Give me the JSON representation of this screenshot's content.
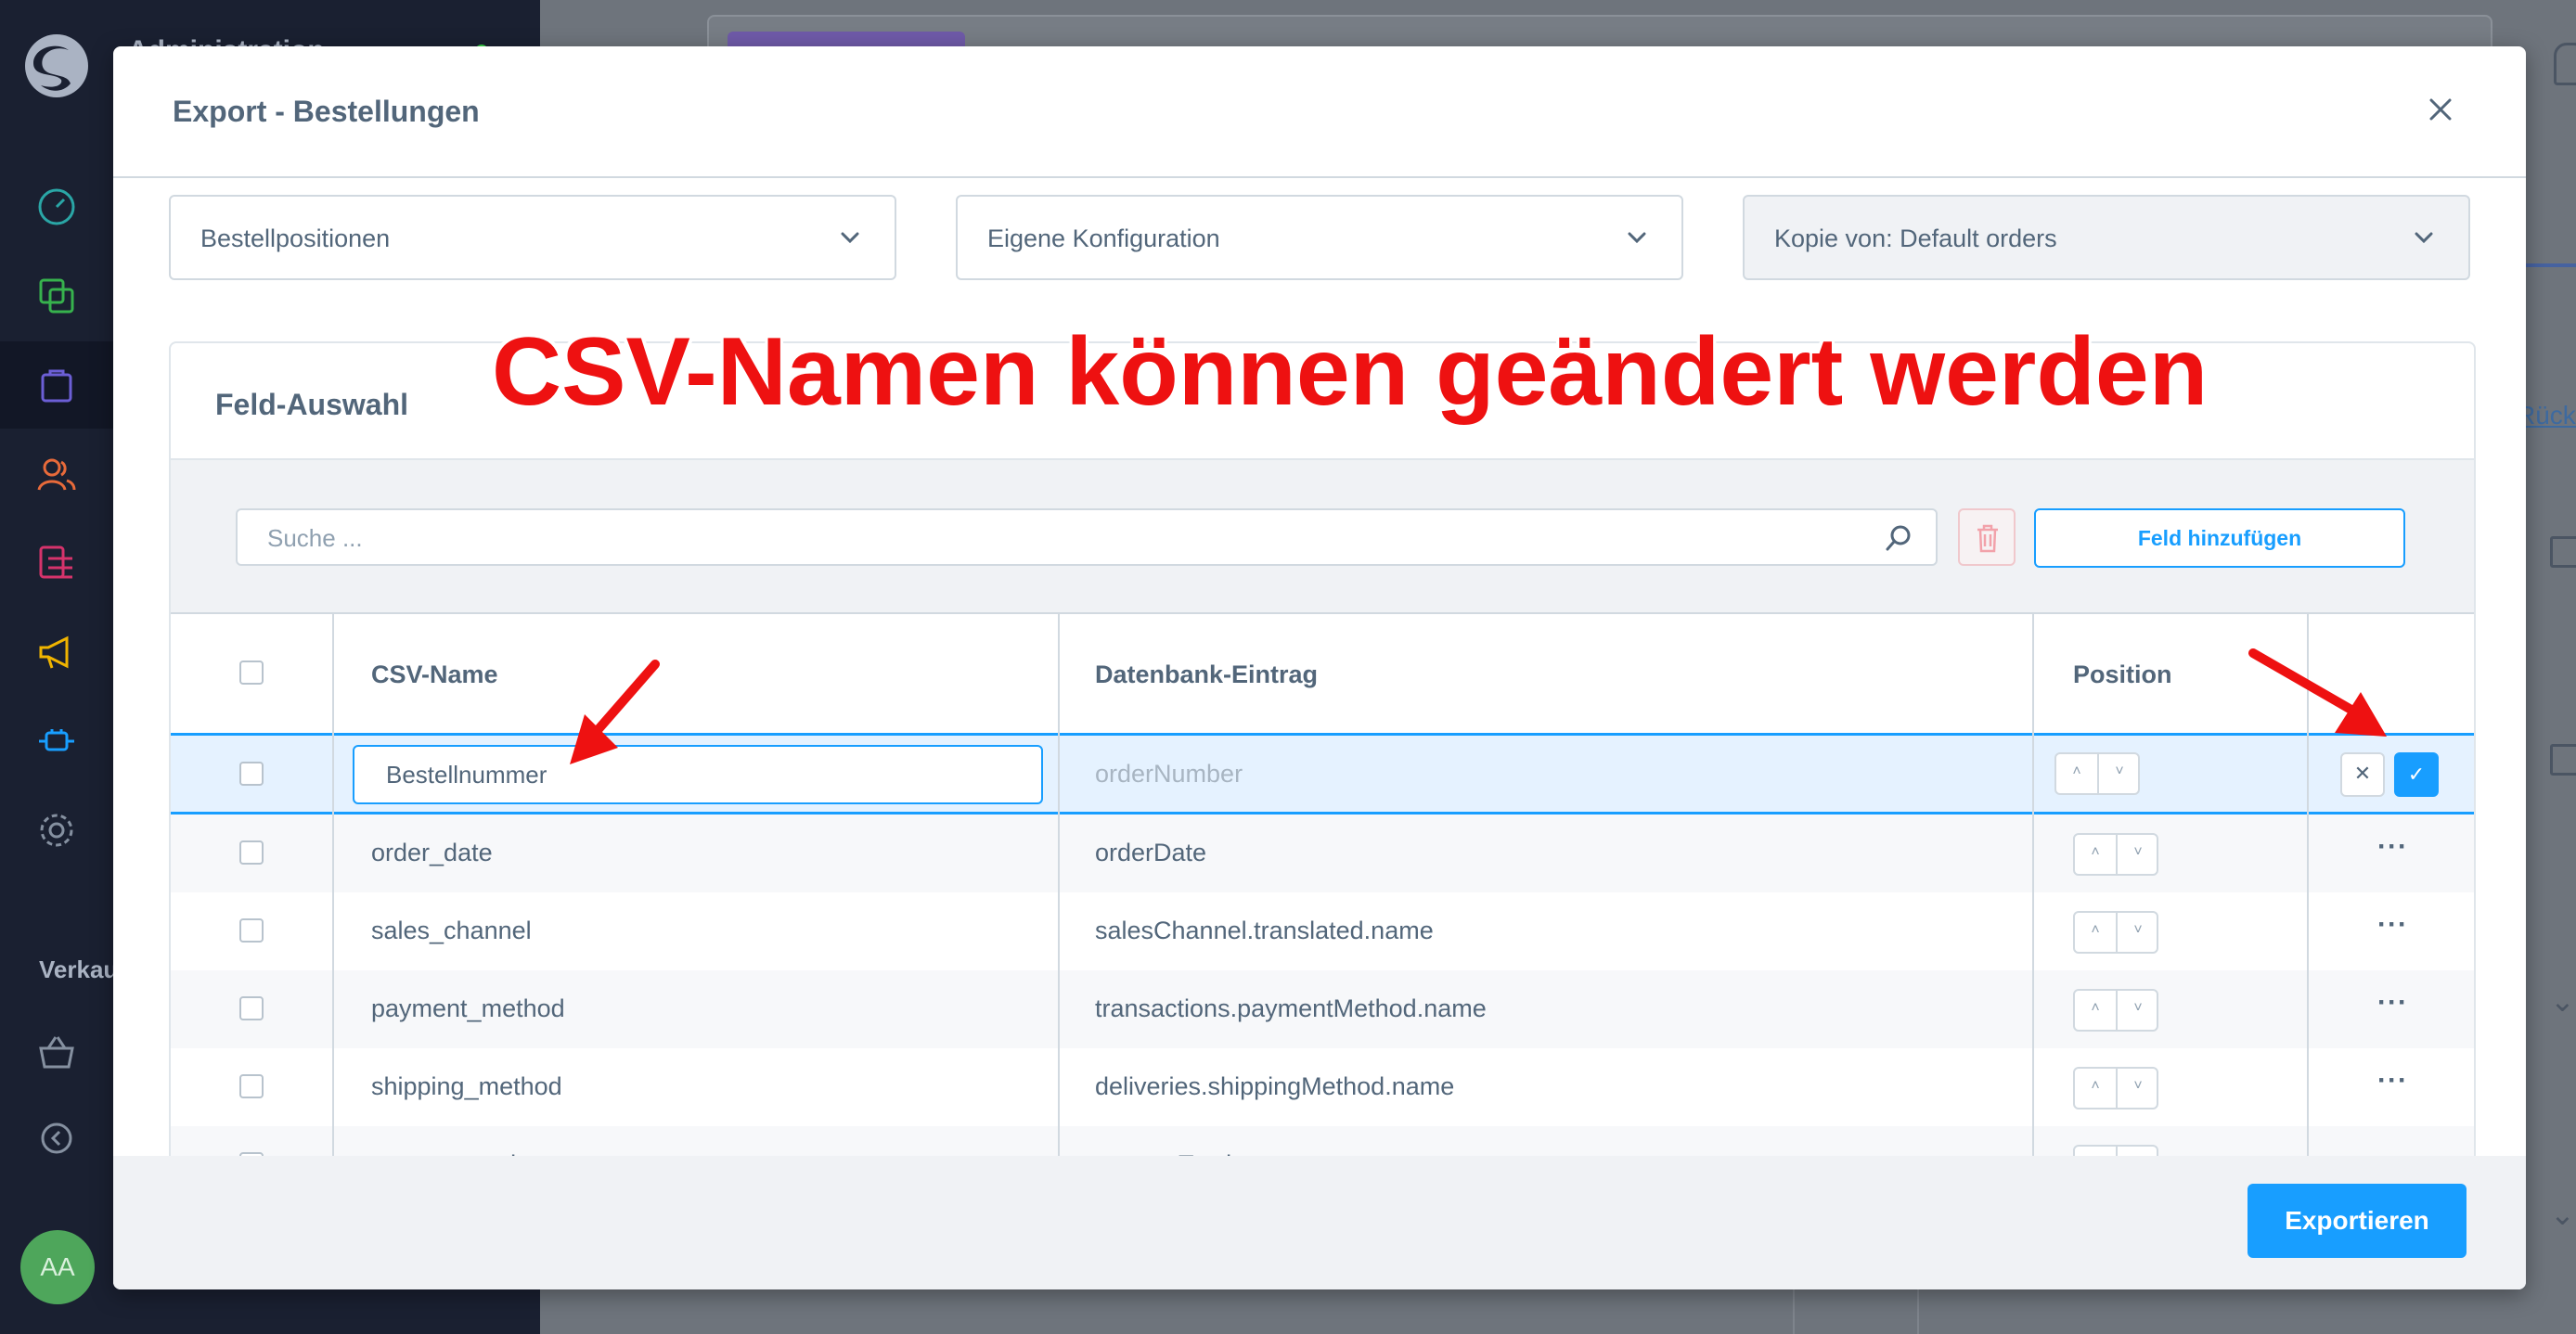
{
  "sidebar": {
    "title": "Administration",
    "sales_label": "Verkaufskanäle",
    "avatar_initials": "AA"
  },
  "background": {
    "link_text": "Rücksetzen"
  },
  "modal": {
    "title": "Export - Bestellungen",
    "selects": [
      {
        "value": "Bestellpositionen"
      },
      {
        "value": "Eigene Konfiguration"
      },
      {
        "value": "Kopie von: Default orders"
      }
    ],
    "card_title": "Feld-Auswahl",
    "search_placeholder": "Suche ...",
    "add_field_label": "Feld hinzufügen",
    "columns": {
      "csv_name": "CSV-Name",
      "db_entry": "Datenbank-Eintrag",
      "position": "Position"
    },
    "editing_row": {
      "csv_name": "Bestellnummer",
      "db_entry": "orderNumber"
    },
    "rows": [
      {
        "csv_name": "order_date",
        "db_entry": "orderDate"
      },
      {
        "csv_name": "sales_channel",
        "db_entry": "salesChannel.translated.name"
      },
      {
        "csv_name": "payment_method",
        "db_entry": "transactions.paymentMethod.name"
      },
      {
        "csv_name": "shipping_method",
        "db_entry": "deliveries.shippingMethod.name"
      },
      {
        "csv_name": "amount_total",
        "db_entry": "amountTotal"
      }
    ],
    "export_label": "Exportieren"
  },
  "annotation": {
    "text": "CSV-Namen können geändert werden"
  },
  "colors": {
    "accent": "#189eff",
    "annotation": "#ee1111",
    "sidebar": "#1a2031"
  }
}
